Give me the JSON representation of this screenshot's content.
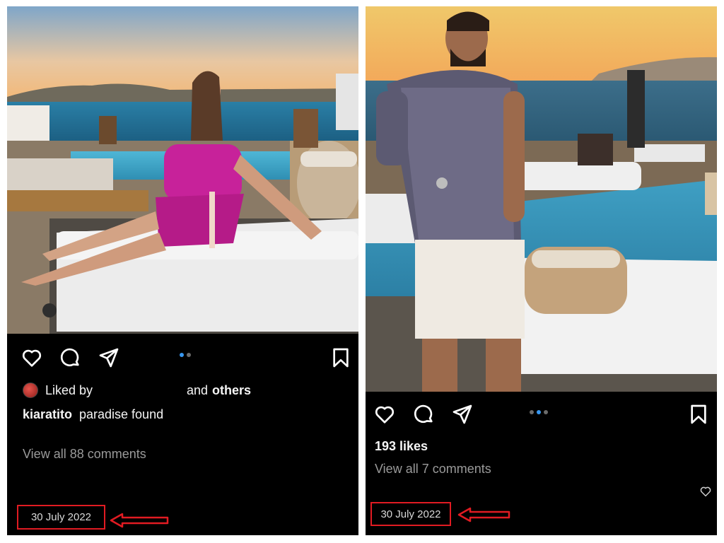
{
  "colors": {
    "background": "#ffffff",
    "panel": "#000000",
    "text": "#f5f5f5",
    "muted_text": "#9a9a9a",
    "dot_active": "#3897f0",
    "dot_inactive": "#6b6b6b",
    "highlight": "#e11b22"
  },
  "left_post": {
    "photo_alt": "woman in pink dress at poolside lounge",
    "carousel": {
      "count": 2,
      "active_index": 0
    },
    "icons": [
      "heart-icon",
      "comment-icon",
      "share-icon",
      "bookmark-icon"
    ],
    "liked_by_prefix": "Liked by",
    "liked_by_suffix": "and",
    "liked_by_others": "others",
    "caption_user": "kiaratito",
    "caption_text": "paradise found",
    "view_comments": "View all 88 comments",
    "date": "30 July 2022"
  },
  "right_post": {
    "photo_alt": "man in patterned shirt standing by pool",
    "carousel": {
      "count": 3,
      "active_index": 1
    },
    "icons": [
      "heart-icon",
      "comment-icon",
      "share-icon",
      "bookmark-icon"
    ],
    "likes": "193 likes",
    "view_comments": "View all 7 comments",
    "date": "30 July 2022"
  }
}
